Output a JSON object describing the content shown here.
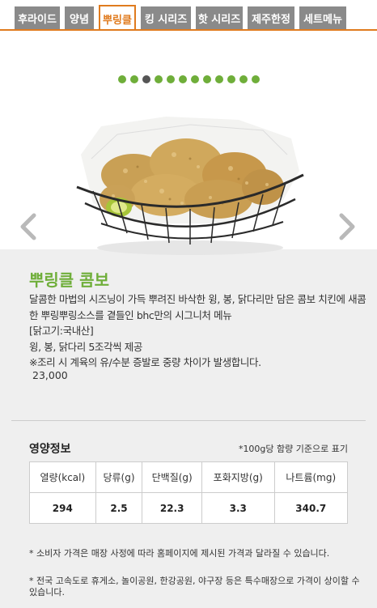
{
  "tabs": [
    {
      "label": "후라이드"
    },
    {
      "label": "양념"
    },
    {
      "label": "뿌링클"
    },
    {
      "label": "킹 시리즈"
    },
    {
      "label": "핫 시리즈"
    },
    {
      "label": "제주한정"
    },
    {
      "label": "세트메뉴"
    }
  ],
  "carousel": {
    "dot_count": 12,
    "active_index": 2
  },
  "product": {
    "name": "뿌링클 콤보",
    "description_lines": [
      "달콤한 마법의 시즈닝이 가득 뿌려진 바삭한 윙, 봉, 닭다리만 담은 콤보 치킨에 새콤",
      "한 뿌링뿌링소스를 곁들인 bhc만의 시그니처 메뉴",
      "[닭고기:국내산]",
      "윙, 봉, 닭다리 5조각씩 제공",
      "※조리 시 계육의 유/수분 증발로 중량 차이가 발생합니다."
    ],
    "price": "23,000"
  },
  "nutrition": {
    "title": "영양정보",
    "note": "*100g당 함량 기준으로 표기",
    "headers": [
      "열량(kcal)",
      "당류(g)",
      "단백질(g)",
      "포화지방(g)",
      "나트륨(mg)"
    ],
    "values": [
      "294",
      "2.5",
      "22.3",
      "3.3",
      "340.7"
    ]
  },
  "footnotes": [
    "* 소비자 가격은 매장 사정에 따라 홈페이지에 제시된 가격과 달라질 수 있습니다.",
    "* 전국 고속도로 휴게소, 놀이공원, 한강공원, 야구장 등은 특수매장으로 가격이 상이할 수 있습니다."
  ],
  "colors": {
    "accent_orange": "#e07b1e",
    "green": "#6fae3a",
    "tab_gray": "#8a8a8a"
  }
}
